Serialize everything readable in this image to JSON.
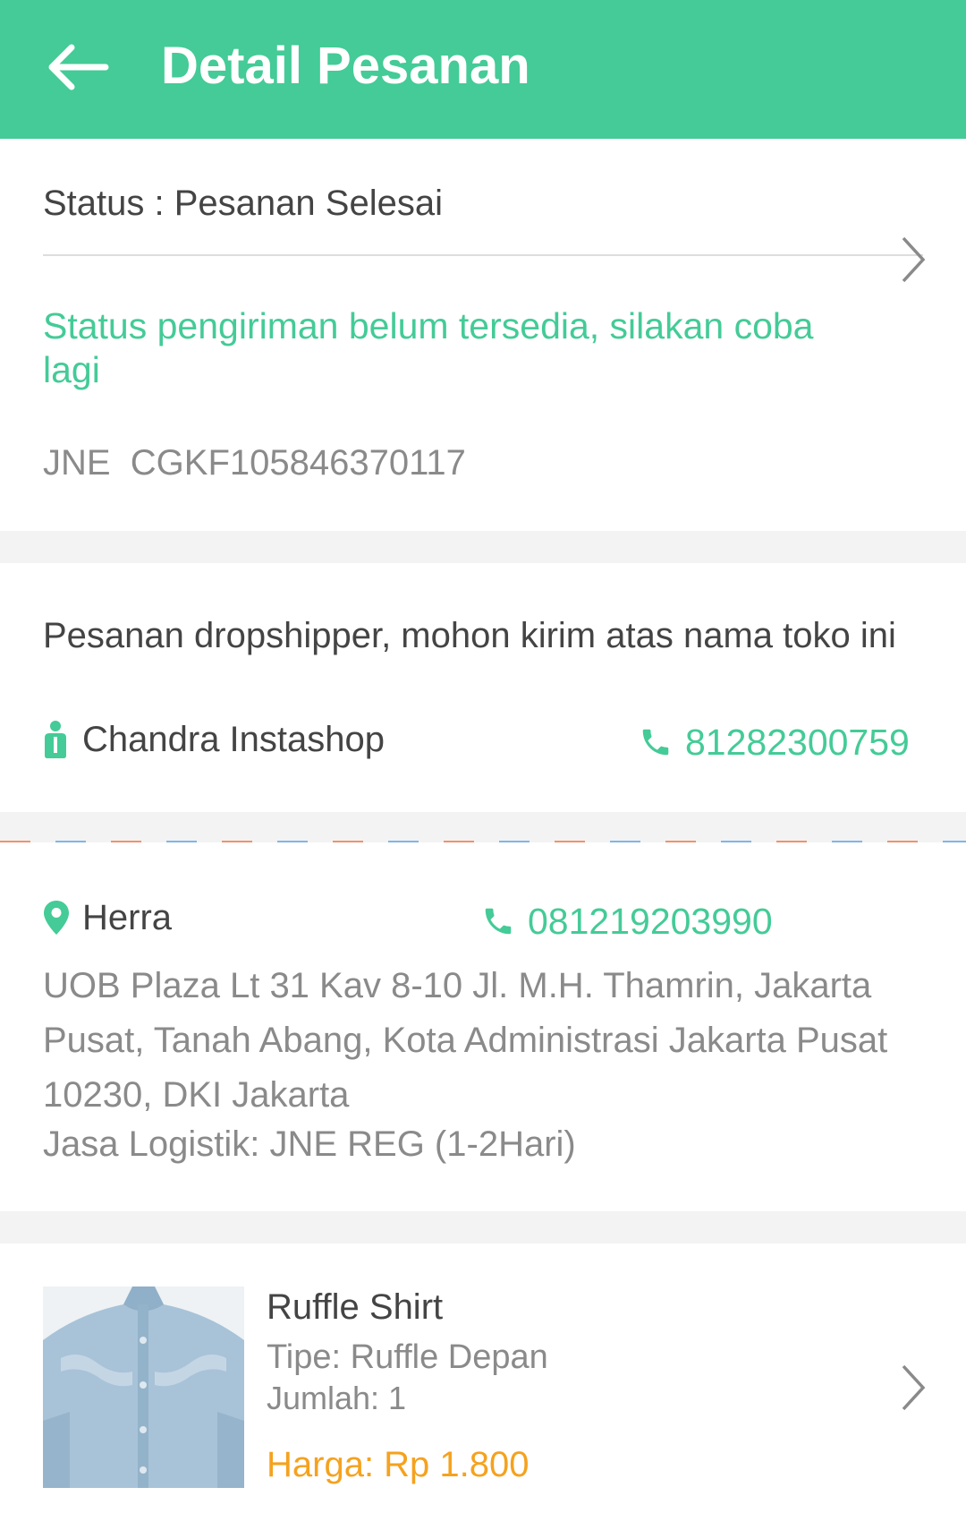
{
  "header": {
    "title": "Detail Pesanan",
    "back_icon": "arrow-left-icon",
    "background": "#44cb97"
  },
  "order_status": {
    "status_text": "Status : Pesanan Selesai",
    "shipping_message": "Status pengiriman belum tersedia, silakan coba lagi",
    "courier": "JNE",
    "tracking_number": "CGKF105846370117",
    "tracking_display": "JNE  CGKF105846370117"
  },
  "dropshipper": {
    "message": "Pesanan dropshipper, mohon kirim atas nama toko ini",
    "store_name": "Chandra Instashop",
    "store_icon": "person-icon",
    "phone": "81282300759",
    "phone_icon": "phone-icon"
  },
  "recipient": {
    "name": "Herra",
    "location_icon": "location-pin-icon",
    "phone": "081219203990",
    "address": "UOB Plaza Lt 31 Kav 8-10 Jl. M.H. Thamrin, Jakarta Pusat, Tanah Abang, Kota Administrasi Jakarta Pusat 10230, DKI Jakarta",
    "logistics": "Jasa Logistik: JNE REG (1-2Hari)"
  },
  "product": {
    "name": "Ruffle Shirt",
    "type": "Tipe: Ruffle Depan",
    "quantity": "Jumlah: 1",
    "price": "Harga: Rp 1.800"
  },
  "colors": {
    "accent": "#44cb97",
    "price": "#f5a21e",
    "text_primary": "#444444",
    "text_secondary": "#8a8a8a"
  }
}
